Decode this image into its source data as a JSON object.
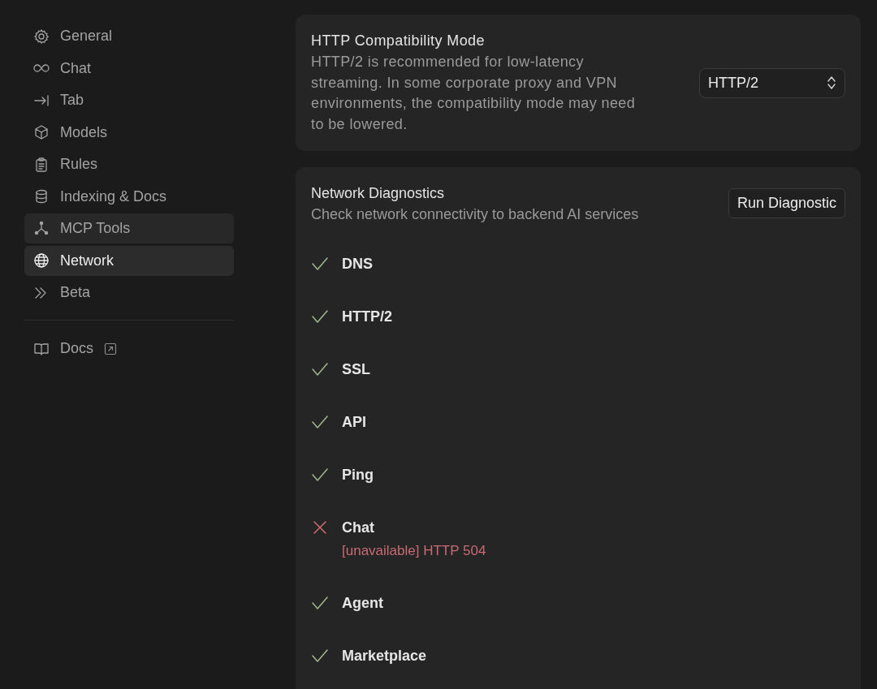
{
  "sidebar": {
    "items": [
      {
        "label": "General",
        "selected": false,
        "hovered": false
      },
      {
        "label": "Chat",
        "selected": false,
        "hovered": false
      },
      {
        "label": "Tab",
        "selected": false,
        "hovered": false
      },
      {
        "label": "Models",
        "selected": false,
        "hovered": false
      },
      {
        "label": "Rules",
        "selected": false,
        "hovered": false
      },
      {
        "label": "Indexing & Docs",
        "selected": false,
        "hovered": false
      },
      {
        "label": "MCP Tools",
        "selected": false,
        "hovered": true
      },
      {
        "label": "Network",
        "selected": true,
        "hovered": false
      },
      {
        "label": "Beta",
        "selected": false,
        "hovered": false
      }
    ],
    "links": [
      {
        "label": "Docs",
        "external": true
      }
    ]
  },
  "http_mode": {
    "title": "HTTP Compatibility Mode",
    "description": "HTTP/2 is recommended for low-latency streaming. In some corporate proxy and VPN environments, the compatibility mode may need to be lowered.",
    "select": {
      "value": "HTTP/2"
    }
  },
  "diagnostics": {
    "title": "Network Diagnostics",
    "description": "Check network connectivity to backend AI services",
    "button": "Run Diagnostic",
    "checks": [
      {
        "name": "DNS",
        "kind": "ok"
      },
      {
        "name": "HTTP/2",
        "kind": "ok"
      },
      {
        "name": "SSL",
        "kind": "ok"
      },
      {
        "name": "API",
        "kind": "ok"
      },
      {
        "name": "Ping",
        "kind": "ok"
      },
      {
        "name": "Chat",
        "kind": "error",
        "message": "[unavailable] HTTP 504"
      },
      {
        "name": "Agent",
        "kind": "ok"
      },
      {
        "name": "Marketplace",
        "kind": "ok"
      }
    ]
  }
}
